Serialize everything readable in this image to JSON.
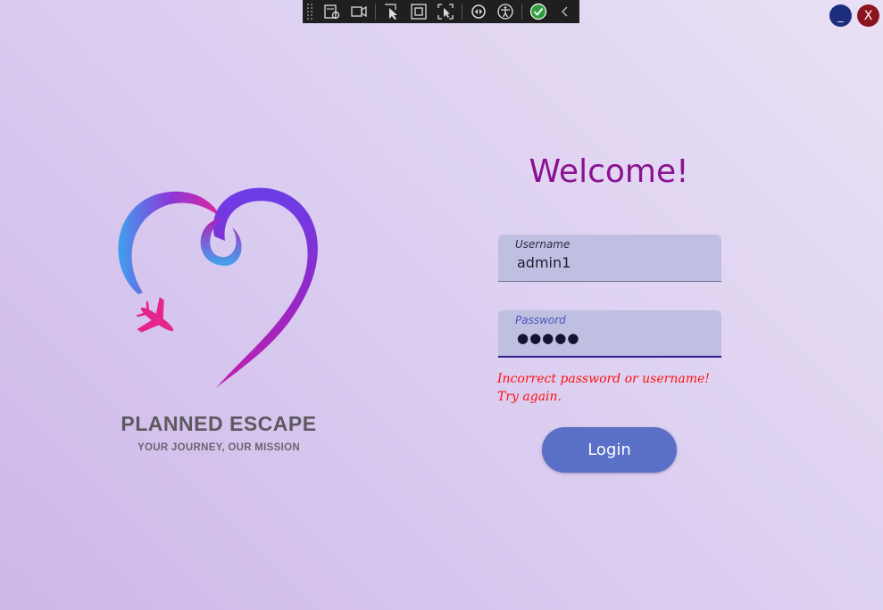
{
  "debug_toolbar": {
    "icons": [
      "live-visual-tree-icon",
      "record-icon",
      "select-element-icon",
      "display-layout-adorners-icon",
      "track-focus-icon",
      "hot-reload-icon",
      "accessibility-icon",
      "binding-failures-check-icon",
      "collapse-chevron-icon"
    ]
  },
  "window": {
    "minimize_label": "_",
    "close_label": "X"
  },
  "brand": {
    "name": "PLANNED ESCAPE",
    "tagline": "YOUR JOURNEY, OUR MISSION"
  },
  "form": {
    "welcome": "Welcome!",
    "username": {
      "label": "Username",
      "value": "admin1"
    },
    "password": {
      "label": "Password",
      "value": "●●●●●"
    },
    "error": "Incorrect password or username! Try again.",
    "login_label": "Login"
  },
  "colors": {
    "welcome": "#8a1191",
    "error": "#ff1010",
    "login_button": "#5a70c6",
    "field_background": "#bfbfe2"
  }
}
